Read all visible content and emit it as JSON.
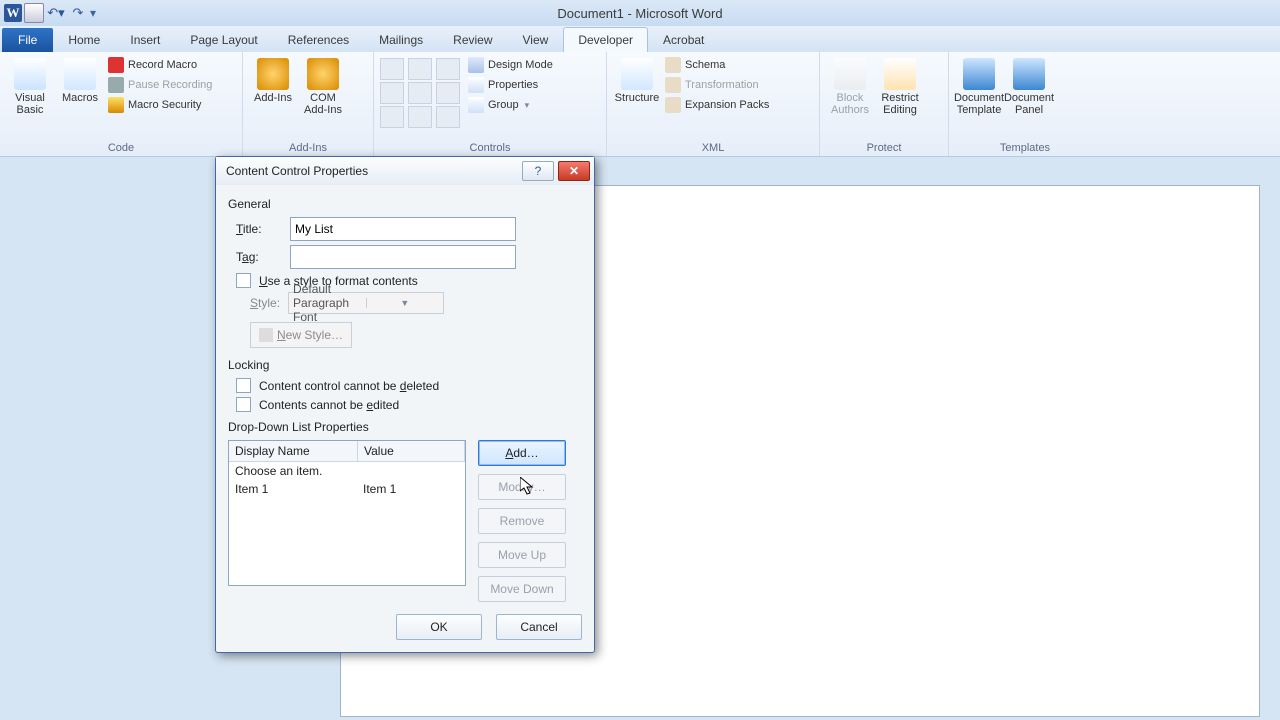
{
  "app": {
    "title": "Document1 - Microsoft Word"
  },
  "tabs": {
    "file": "File",
    "items": [
      "Home",
      "Insert",
      "Page Layout",
      "References",
      "Mailings",
      "Review",
      "View",
      "Developer",
      "Acrobat"
    ],
    "active": "Developer"
  },
  "ribbon": {
    "code": {
      "title": "Code",
      "visual_basic": "Visual\nBasic",
      "macros": "Macros",
      "record": "Record Macro",
      "pause": "Pause Recording",
      "security": "Macro Security"
    },
    "addins": {
      "title": "Add-Ins",
      "addins": "Add-Ins",
      "com": "COM\nAdd-Ins"
    },
    "controls": {
      "title": "Controls",
      "design": "Design Mode",
      "properties": "Properties",
      "group": "Group"
    },
    "xml": {
      "title": "XML",
      "structure": "Structure",
      "schema": "Schema",
      "transformation": "Transformation",
      "expansion": "Expansion Packs"
    },
    "protect": {
      "title": "Protect",
      "block": "Block\nAuthors",
      "restrict": "Restrict\nEditing"
    },
    "templates": {
      "title": "Templates",
      "doc_template": "Document\nTemplate",
      "doc_panel": "Document\nPanel"
    }
  },
  "dialog": {
    "title": "Content Control Properties",
    "general": "General",
    "title_label": "Title:",
    "title_value": "My List",
    "tag_label": "Tag:",
    "tag_value": "",
    "use_style": "Use a style to format contents",
    "style_label": "Style:",
    "style_value": "Default Paragraph Font",
    "new_style": "New Style…",
    "locking": "Locking",
    "lock_delete": "Content control cannot be deleted",
    "lock_edit": "Contents cannot be edited",
    "ddl_section": "Drop-Down List Properties",
    "col_name": "Display Name",
    "col_value": "Value",
    "rows": [
      {
        "name": "Choose an item.",
        "value": ""
      },
      {
        "name": "Item 1",
        "value": "Item 1"
      }
    ],
    "btns": {
      "add": "Add…",
      "modify": "Modify…",
      "remove": "Remove",
      "moveup": "Move Up",
      "movedown": "Move Down"
    },
    "ok": "OK",
    "cancel": "Cancel"
  }
}
